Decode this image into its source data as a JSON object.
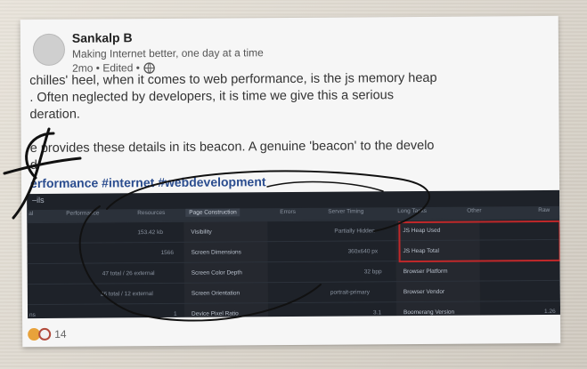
{
  "author": {
    "name": "Sankalp B",
    "tagline": "Making Internet better, one day at a time",
    "meta": "2mo • Edited •"
  },
  "post": {
    "lines": [
      "chilles' heel, when it comes to web performance, is the js memory heap",
      ". Often neglected by developers, it is time we give this a serious",
      "deration.",
      "",
      "e provides these details in its beacon. A genuine 'beacon' to the develo",
      "d"
    ],
    "hashtags": "erformance #internet #webdevelopment"
  },
  "screenshot": {
    "title": "–ils",
    "tabs": [
      "al",
      "Performance",
      "Resources",
      "Page Construction",
      "Errors",
      "Server Timing",
      "Long Tasks",
      "Other",
      "Raw"
    ],
    "rows": [
      {
        "value1": "153.42 kb",
        "label1": "Visibility",
        "value2": "Partially Hidden",
        "label2": "JS Heap Used",
        "value3": ""
      },
      {
        "value1": "1566",
        "label1": "Screen Dimensions",
        "value2": "360x640 px",
        "label2": "JS Heap Total",
        "value3": ""
      },
      {
        "value1": "47 total / 26 external",
        "label1": "Screen Color Depth",
        "value2": "32 bpp",
        "label2": "Browser Platform",
        "value3": ""
      },
      {
        "value1": "26 total / 12 external",
        "label1": "Screen Orientation",
        "value2": "portrait-primary",
        "label2": "Browser Vendor",
        "value3": ""
      },
      {
        "value1": "1",
        "label1": "Device Pixel Ratio",
        "value2": "3.1",
        "label2": "Boomerang Version",
        "value3": "1.26"
      }
    ],
    "row_prefix": [
      "",
      "",
      "",
      "",
      "ns"
    ]
  },
  "footer": {
    "reaction_count": "14"
  },
  "colors": {
    "hashtag": "#2b4d8f",
    "highlight_border": "#c0282a",
    "screenshot_bg": "#1e2229"
  }
}
